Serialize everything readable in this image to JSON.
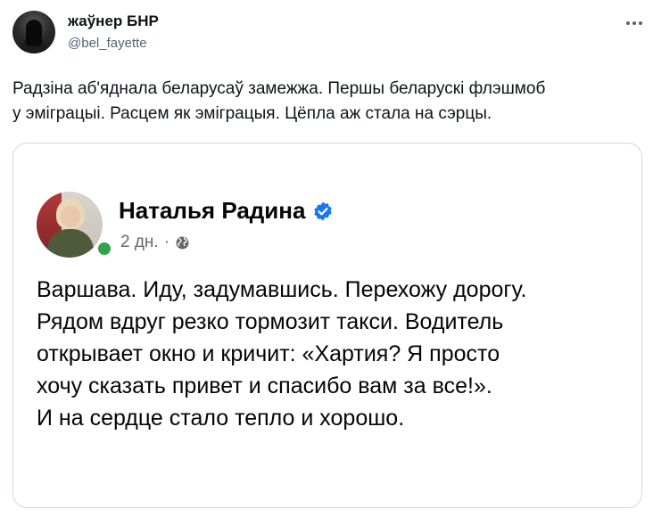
{
  "author": {
    "name": "жаўнер БНР",
    "handle": "@bel_fayette"
  },
  "tweet": {
    "text_line1": "Радзіна аб'яднала беларусаў замежжа. Першы беларускі флэшмоб",
    "text_line2": "у эміграцыі. Расцем як эміграцыя. Цёпла аж стала на сэрцы."
  },
  "quoted_post": {
    "author_name": "Наталья Радина",
    "time": "2 дн.",
    "separator": "·",
    "text_lines": [
      "Варшава. Иду, задумавшись. Перехожу дорогу.",
      "Рядом вдруг резко тормозит такси. Водитель",
      "открывает окно и кричит: «Хартия? Я просто",
      "хочу сказать привет и спасибо вам за все!».",
      "И на сердце стало тепло и хорошо."
    ]
  },
  "icons": {
    "more": "more-horizontal-icon",
    "verified": "verified-badge-icon",
    "globe": "globe-icon"
  },
  "colors": {
    "text_primary": "#0f1419",
    "text_secondary": "#536471",
    "verified_blue": "#1877f2",
    "online_green": "#31a24c",
    "card_border": "#cfd9de"
  }
}
